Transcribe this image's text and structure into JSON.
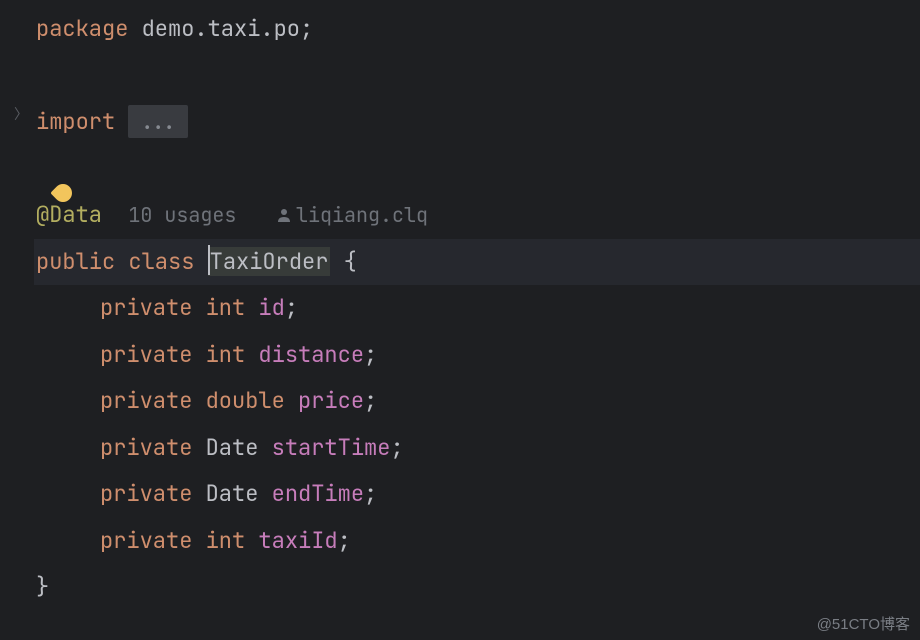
{
  "code": {
    "package_kw": "package",
    "package_name": "demo.taxi.po",
    "import_kw": "import",
    "folded_imports": "...",
    "annotation": "@Data",
    "usages_hint": "10 usages",
    "author_name": "liqiang.clq",
    "public_kw": "public",
    "class_kw": "class",
    "class_name": "TaxiOrder",
    "open_brace": "{",
    "close_brace": "}",
    "semicolon": ";",
    "private_kw": "private",
    "type_int": "int",
    "type_double": "double",
    "type_date": "Date",
    "fields": {
      "id": "id",
      "distance": "distance",
      "price": "price",
      "startTime": "startTime",
      "endTime": "endTime",
      "taxiId": "taxiId"
    }
  },
  "watermark": "@51CTO博客"
}
